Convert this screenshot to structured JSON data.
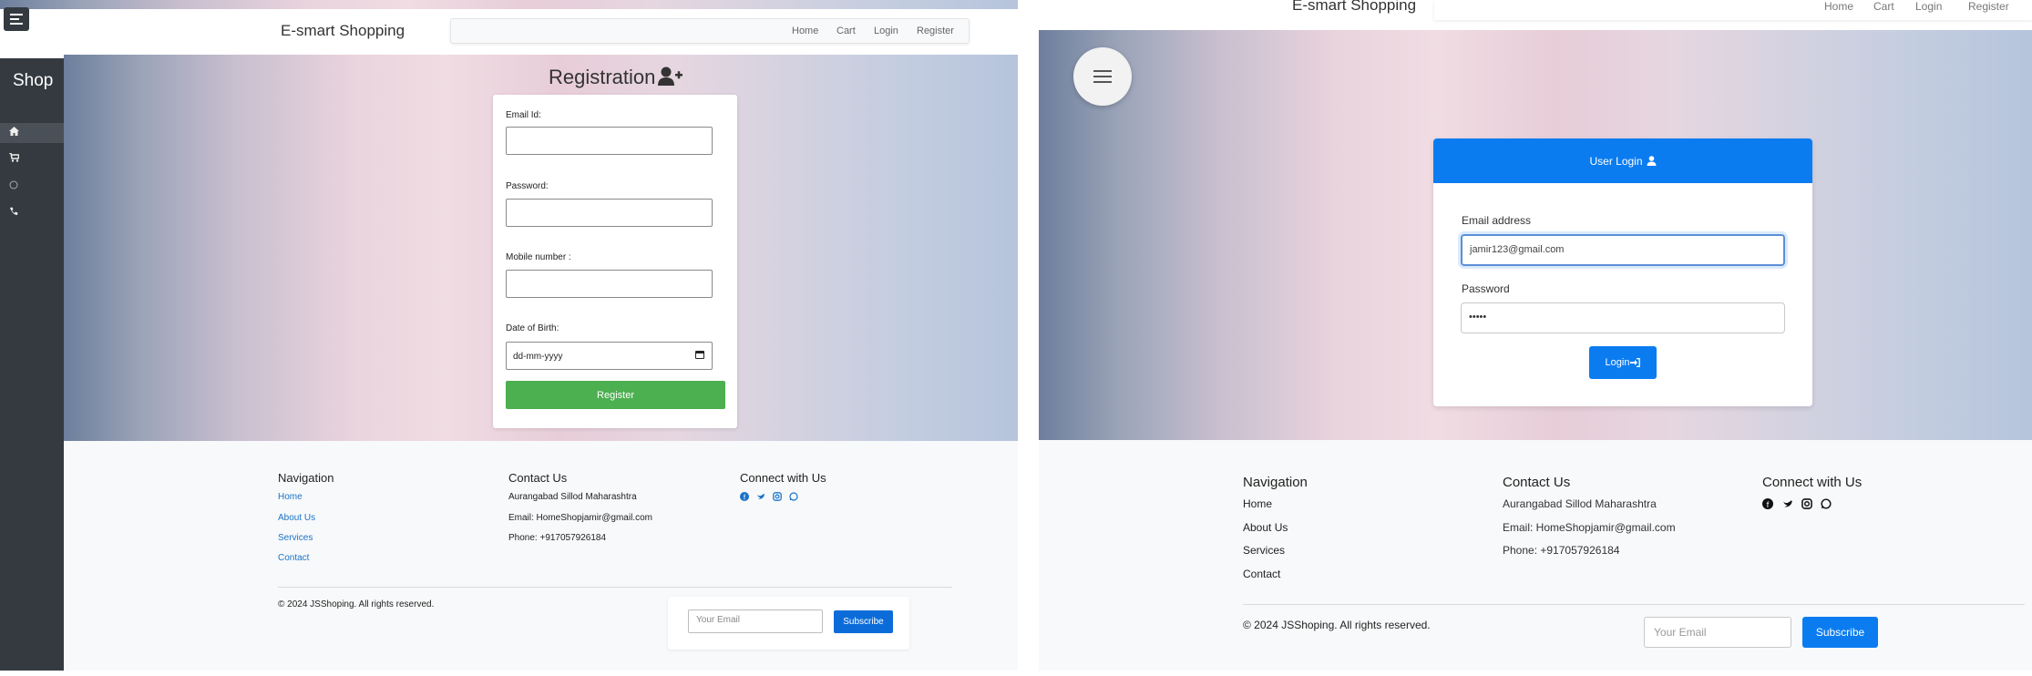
{
  "left": {
    "brand": "E-smart Shopping",
    "nav": [
      "Home",
      "Cart",
      "Login",
      "Register"
    ],
    "sidebar": {
      "title": "Shop",
      "items": [
        {
          "icon": "home-icon"
        },
        {
          "icon": "cart-icon"
        },
        {
          "icon": "info-icon"
        },
        {
          "icon": "phone-icon"
        }
      ]
    },
    "registration": {
      "title": "Registration",
      "icon": "user-plus-icon",
      "email_label": "Email Id:",
      "password_label": "Password:",
      "mobile_label": "Mobile number :",
      "dob_label": "Date of Birth:",
      "dob_placeholder": "dd-mm-yyyy",
      "register_label": "Register"
    },
    "footer": {
      "nav_heading": "Navigation",
      "links": [
        "Home",
        "About Us",
        "Services",
        "Contact"
      ],
      "contact_heading": "Contact Us",
      "address": "Aurangabad Sillod Maharashtra",
      "email": "Email: HomeShopjamir@gmail.com",
      "phone": "Phone: +917057926184",
      "connect_heading": "Connect with Us",
      "social": [
        "facebook-icon",
        "twitter-icon",
        "instagram-icon",
        "whatsapp-icon"
      ],
      "copyright": "© 2024 JSShoping. All rights reserved.",
      "email_placeholder": "Your Email",
      "subscribe_label": "Subscribe"
    }
  },
  "right": {
    "brand": "E-smart Shopping",
    "nav": [
      "Home",
      "Cart",
      "Login",
      "Register"
    ],
    "login": {
      "title": "User Login",
      "email_label": "Email address",
      "email_value": "jamir123@gmail.com",
      "password_label": "Password",
      "password_value": "•••••",
      "login_label": "Login"
    },
    "footer": {
      "nav_heading": "Navigation",
      "links": [
        "Home",
        "About Us",
        "Services",
        "Contact"
      ],
      "contact_heading": "Contact Us",
      "address": "Aurangabad Sillod Maharashtra",
      "email": "Email: HomeShopjamir@gmail.com",
      "phone": "Phone: +917057926184",
      "connect_heading": "Connect with Us",
      "social": [
        "facebook-icon",
        "twitter-icon",
        "instagram-icon",
        "whatsapp-icon"
      ],
      "copyright": "© 2024 JSShoping. All rights reserved.",
      "email_placeholder": "Your Email",
      "subscribe_label": "Subscribe"
    }
  },
  "colors": {
    "primary_blue": "#0b7cf0",
    "register_green": "#4caf50",
    "sidebar_dark": "#343a40",
    "link_blue": "#1a73c8"
  }
}
